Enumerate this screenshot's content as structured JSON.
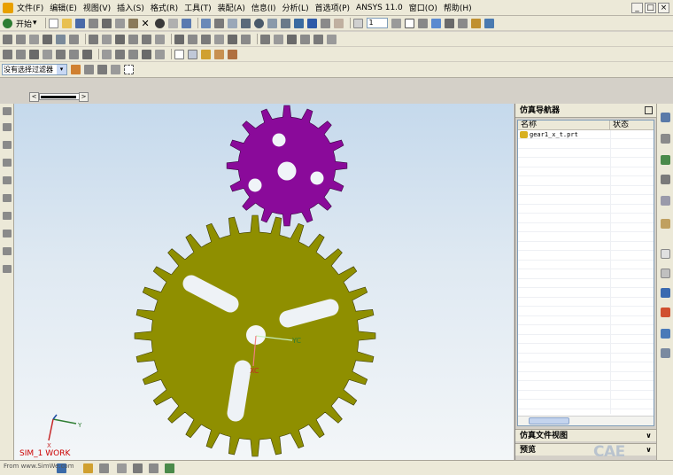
{
  "menubar": {
    "items": [
      "文件(F)",
      "编辑(E)",
      "视图(V)",
      "插入(S)",
      "格式(R)",
      "工具(T)",
      "装配(A)",
      "信息(I)",
      "分析(L)",
      "首选项(P)",
      "ANSYS 11.0",
      "窗口(O)",
      "帮助(H)"
    ],
    "window_buttons": [
      "_",
      "□",
      "×"
    ]
  },
  "toolbar": {
    "start_label": "开始",
    "start_arrow": "▾",
    "layer_value": "1"
  },
  "filter": {
    "value": "没有选择过滤器",
    "dropdown_arrow": "▾"
  },
  "tabs": {
    "left_arrow": "<",
    "right_arrow": ">"
  },
  "navigator": {
    "title": "仿真导航器",
    "col_name": "名称",
    "col_status": "状态",
    "file_item": "gear1_x_t.prt",
    "section1": "仿真文件视图",
    "section2": "预览",
    "chevron": "∨"
  },
  "viewport": {
    "work_label": "SIM_1 WORK",
    "axis_y": "Y",
    "axis_x": "X",
    "gear_axis_yc": "YC",
    "gear_axis_xc": "XC",
    "colors": {
      "small_gear": "#8a0a9a",
      "large_gear": "#8f8f00"
    }
  },
  "statusbar": {
    "url_text": "From www.SimWe.com",
    "logo": "CAE"
  }
}
